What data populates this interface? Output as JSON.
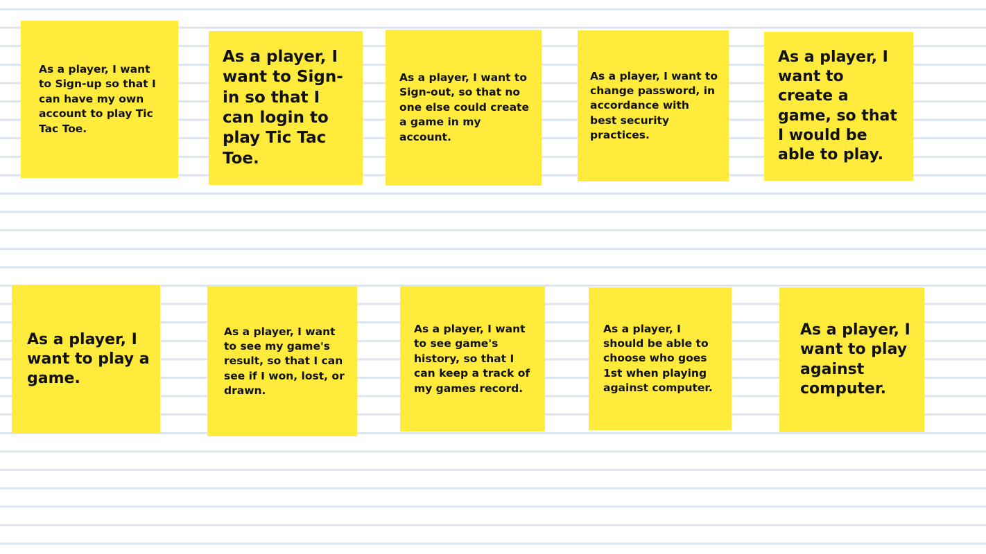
{
  "notes": [
    {
      "text": "As a player, I want to Sign-up so that I can have my own account to play Tic Tac Toe."
    },
    {
      "text": "As a player, I want to Sign-in so that I can login to play Tic Tac Toe."
    },
    {
      "text": "As a player, I want to Sign-out, so that no one else could create a game in my account."
    },
    {
      "text": "As a player, I want to change password, in accordance with best security practices."
    },
    {
      "text": "As a player, I want to create a game, so that I would be able to play."
    },
    {
      "text": "As a player, I want to play a game."
    },
    {
      "text": "As a player, I want to see my game's result, so that I can see if I won, lost, or drawn."
    },
    {
      "text": "As a player, I want to see game's history, so that I can keep a track of my games record."
    },
    {
      "text": "As a player, I should be able to choose who goes 1st when playing against computer."
    },
    {
      "text": "As a player, I want to play against computer."
    }
  ]
}
